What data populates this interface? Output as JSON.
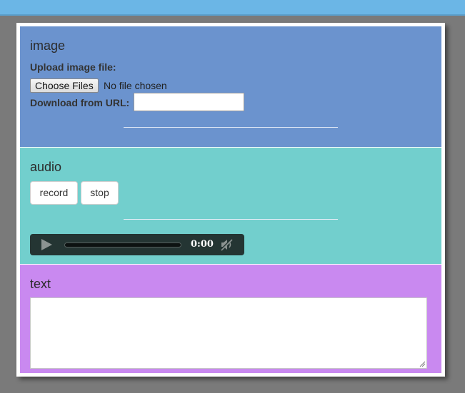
{
  "image_section": {
    "title": "image",
    "upload_label": "Upload image file:",
    "choose_button": "Choose Files",
    "file_status": "No file chosen",
    "url_label": "Download from URL:",
    "url_value": ""
  },
  "audio_section": {
    "title": "audio",
    "record_button": "record",
    "stop_button": "stop",
    "player": {
      "time": "0:00",
      "progress": 0
    }
  },
  "text_section": {
    "title": "text",
    "text_value": ""
  },
  "colors": {
    "image_panel": "#6b93ce",
    "audio_panel": "#72cfcd",
    "text_panel": "#c989f0",
    "top_bar": "#6bb6e6",
    "background": "#7a7a7a"
  }
}
